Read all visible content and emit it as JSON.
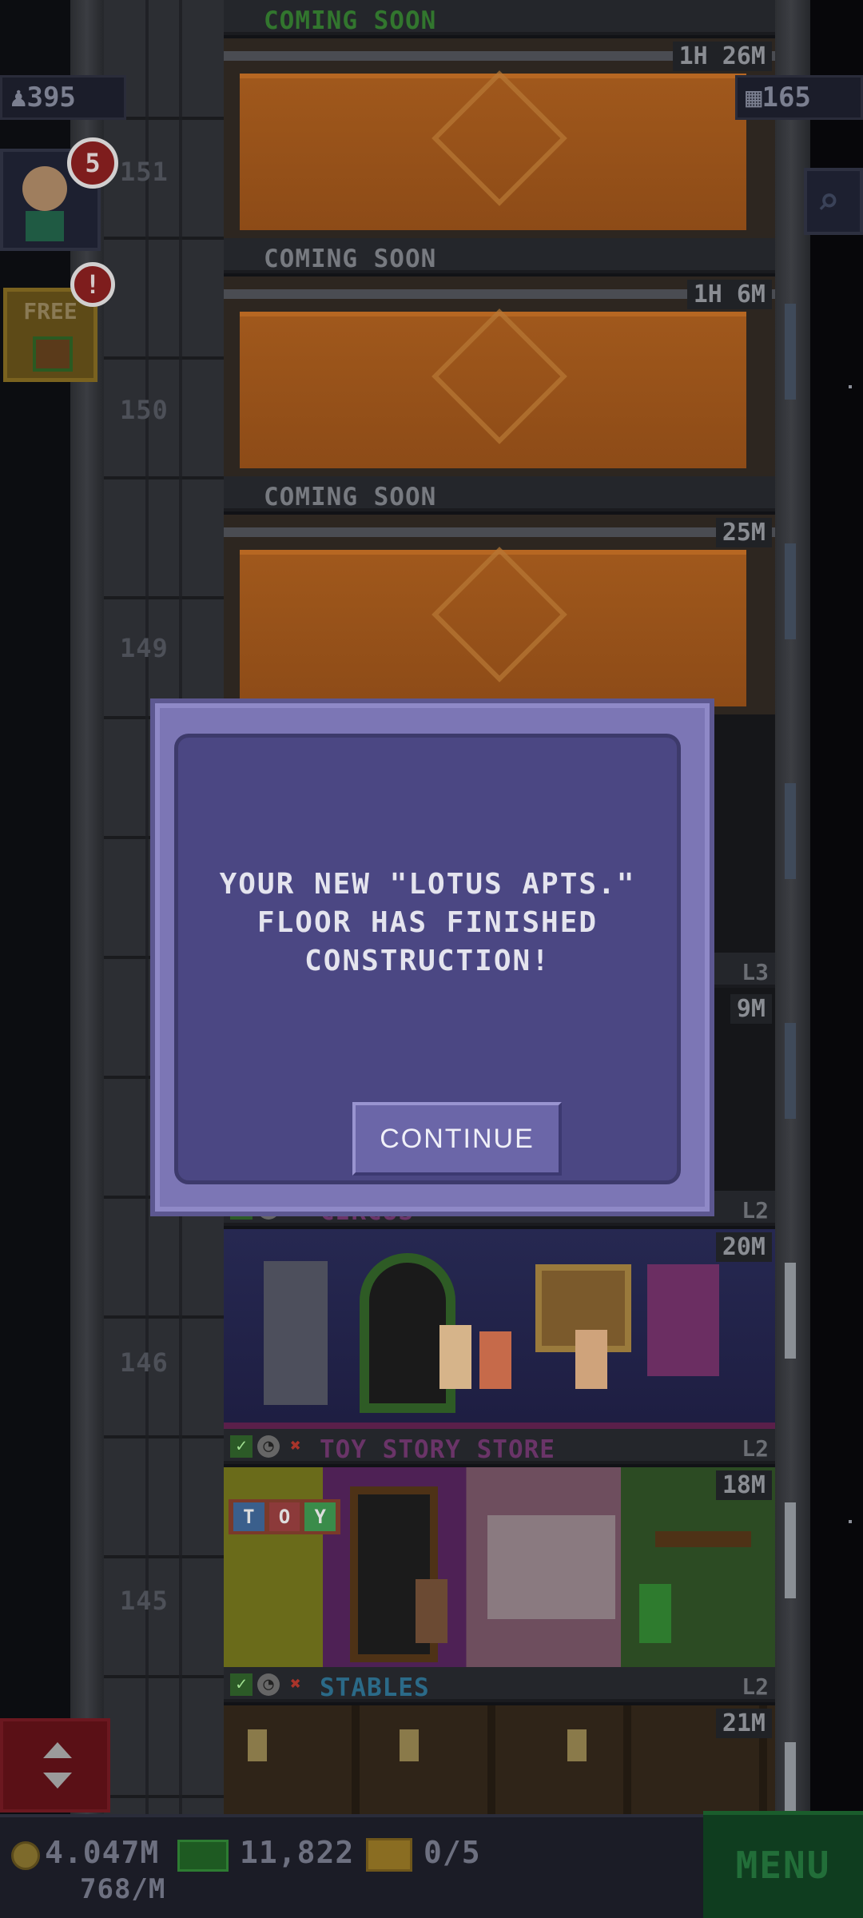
{
  "hud": {
    "population": "395",
    "floors": "165",
    "citizen_notifications": "5",
    "free_label": "FREE",
    "free_alert": "!"
  },
  "floor_numbers": [
    "151",
    "150",
    "149",
    "146",
    "145"
  ],
  "floors": [
    {
      "name": "COMING SOON",
      "timer": "1H 26M",
      "state": "construction"
    },
    {
      "name": "COMING SOON",
      "timer": "1H 6M",
      "state": "construction"
    },
    {
      "name": "COMING SOON",
      "timer": "25M",
      "state": "construction"
    },
    {
      "name": "",
      "level": "L3",
      "timer": "9M",
      "state": "hidden"
    },
    {
      "name": "CIRCUS",
      "level": "L2",
      "timer": "20M",
      "state": "open"
    },
    {
      "name": "TOY STORY STORE",
      "level": "L2",
      "timer": "18M",
      "state": "open"
    },
    {
      "name": "STABLES",
      "level": "L2",
      "timer": "21M",
      "state": "open"
    }
  ],
  "toy_sign": [
    "T",
    "O",
    "Y"
  ],
  "dialog": {
    "message_line1": "YOUR NEW \"LOTUS APTS.\"",
    "message_line2": "FLOOR HAS FINISHED",
    "message_line3": "CONSTRUCTION!",
    "continue_label": "CONTINUE"
  },
  "bottom_bar": {
    "coins": "4.047M",
    "coins_rate": "768/M",
    "bux": "11,822",
    "tickets": "0/5",
    "menu_label": "MENU"
  },
  "colors": {
    "dialog_frame": "#7c76b5",
    "dialog_panel": "#4b4783",
    "construction_orange": "#a0581c",
    "menu_green": "#0f3d1f",
    "badge_red": "#7e1d1d"
  }
}
